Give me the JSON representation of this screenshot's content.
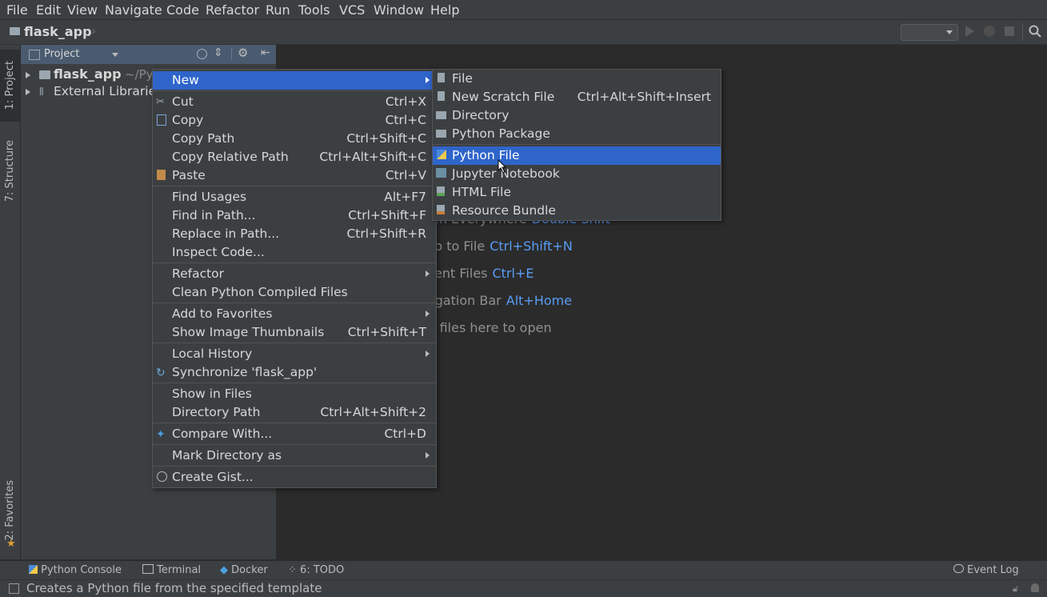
{
  "menubar": {
    "items": [
      "File",
      "Edit",
      "View",
      "Navigate",
      "Code",
      "Refactor",
      "Run",
      "Tools",
      "VCS",
      "Window",
      "Help"
    ]
  },
  "navbar": {
    "breadcrumb": "flask_app"
  },
  "left_stripe": {
    "tab_project": "1: Project",
    "tab_structure": "7: Structure",
    "tab_favorites": "2: Favorites"
  },
  "project_panel": {
    "title": "Project",
    "tree": [
      {
        "label": "flask_app",
        "path": "~/PyProject/flask"
      },
      {
        "label": "External Libraries"
      }
    ]
  },
  "editor_hints": [
    {
      "text": "Search Everywhere",
      "key": "Double Shift"
    },
    {
      "text": "Go to File",
      "key": "Ctrl+Shift+N"
    },
    {
      "text": "Recent Files",
      "key": "Ctrl+E"
    },
    {
      "text": "Navigation Bar",
      "key": "Alt+Home"
    },
    {
      "text": "Drop files here to open",
      "key": ""
    }
  ],
  "context_menu": {
    "items": [
      {
        "label": "New",
        "shortcut": "",
        "submenu": true,
        "icon": ""
      },
      {
        "label": "Cut",
        "shortcut": "Ctrl+X",
        "icon": "scissors-icon"
      },
      {
        "label": "Copy",
        "shortcut": "Ctrl+C",
        "icon": "copy-icon"
      },
      {
        "label": "Copy Path",
        "shortcut": "Ctrl+Shift+C"
      },
      {
        "label": "Copy Relative Path",
        "shortcut": "Ctrl+Alt+Shift+C"
      },
      {
        "label": "Paste",
        "shortcut": "Ctrl+V",
        "icon": "paste-icon"
      },
      {
        "label": "Find Usages",
        "shortcut": "Alt+F7"
      },
      {
        "label": "Find in Path...",
        "shortcut": "Ctrl+Shift+F"
      },
      {
        "label": "Replace in Path...",
        "shortcut": "Ctrl+Shift+R"
      },
      {
        "label": "Inspect Code...",
        "shortcut": ""
      },
      {
        "label": "Refactor",
        "shortcut": "",
        "submenu": true
      },
      {
        "label": "Clean Python Compiled Files",
        "shortcut": ""
      },
      {
        "label": "Add to Favorites",
        "shortcut": "",
        "submenu": true
      },
      {
        "label": "Show Image Thumbnails",
        "shortcut": "Ctrl+Shift+T"
      },
      {
        "label": "Local History",
        "shortcut": "",
        "submenu": true
      },
      {
        "label": "Synchronize 'flask_app'",
        "shortcut": "",
        "icon": "sync-icon"
      },
      {
        "label": "Show in Files",
        "shortcut": ""
      },
      {
        "label": "Directory Path",
        "shortcut": "Ctrl+Alt+Shift+2"
      },
      {
        "label": "Compare With...",
        "shortcut": "Ctrl+D",
        "icon": "compare-icon"
      },
      {
        "label": "Mark Directory as",
        "shortcut": "",
        "submenu": true
      },
      {
        "label": "Create Gist...",
        "shortcut": "",
        "icon": "github-icon"
      }
    ]
  },
  "new_submenu": {
    "items": [
      {
        "label": "File",
        "shortcut": ""
      },
      {
        "label": "New Scratch File",
        "shortcut": "Ctrl+Alt+Shift+Insert"
      },
      {
        "label": "Directory",
        "shortcut": ""
      },
      {
        "label": "Python Package",
        "shortcut": ""
      },
      {
        "label": "Python File",
        "shortcut": ""
      },
      {
        "label": "Jupyter Notebook",
        "shortcut": ""
      },
      {
        "label": "HTML File",
        "shortcut": ""
      },
      {
        "label": "Resource Bundle",
        "shortcut": ""
      }
    ]
  },
  "bottom_tabs": {
    "python_console": "Python Console",
    "terminal": "Terminal",
    "docker": "Docker",
    "todo": "6: TODO",
    "event_log": "Event Log"
  },
  "status": {
    "message": "Creates a Python file from the specified template"
  },
  "colors": {
    "selection": "#2f65ca",
    "panel": "#3c3f41",
    "editor": "#2b2b2b",
    "key_hint": "#589df6"
  }
}
